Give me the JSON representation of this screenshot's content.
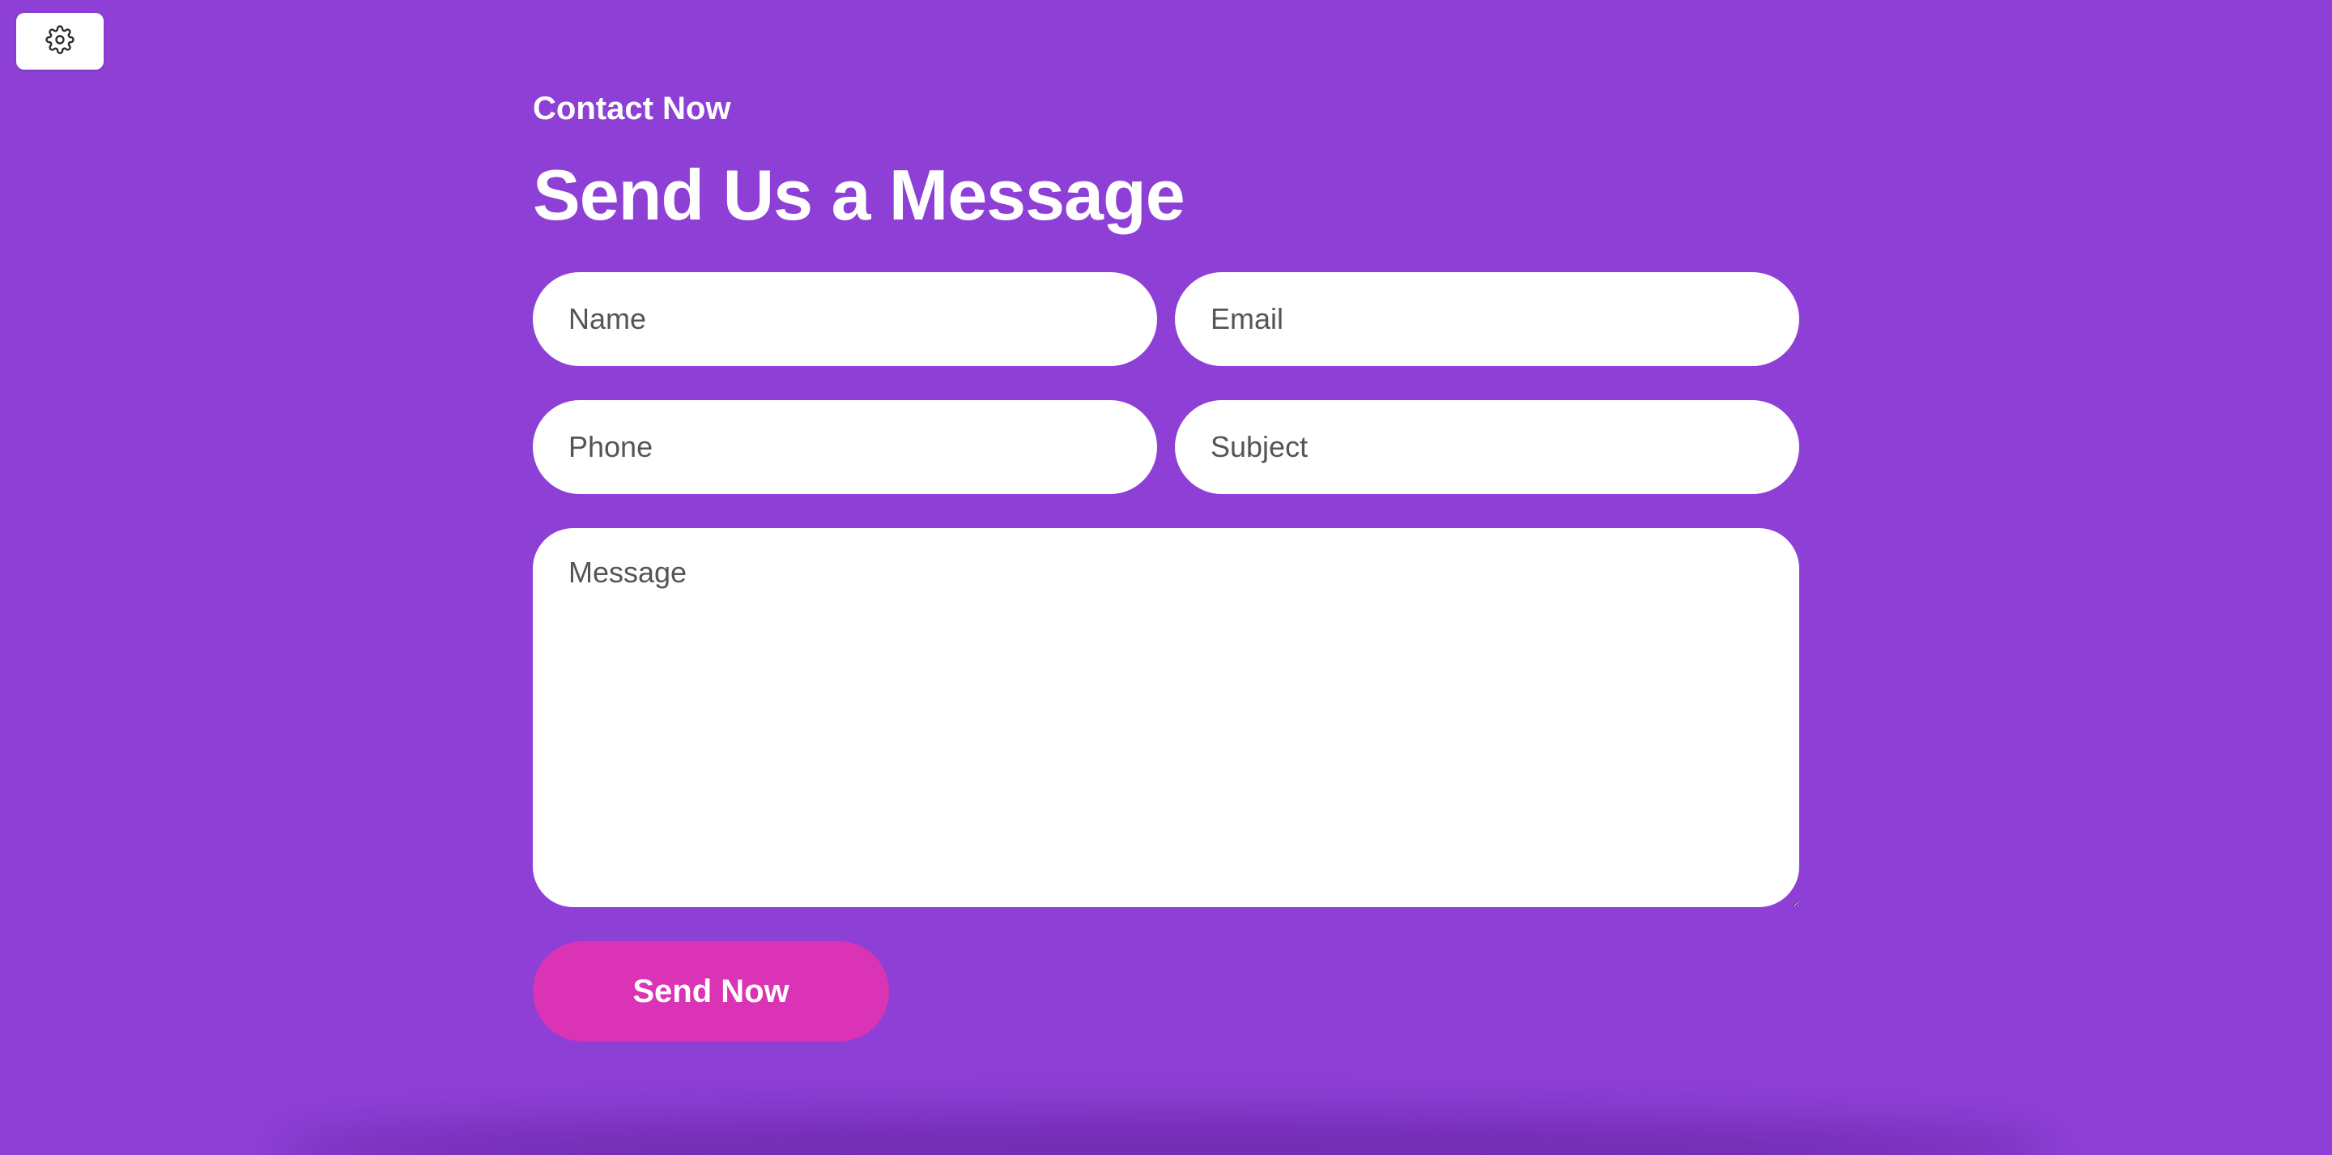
{
  "toolbar": {
    "settings_icon": "gear-icon"
  },
  "header": {
    "eyebrow": "Contact Now",
    "title": "Send Us a Message"
  },
  "form": {
    "name_placeholder": "Name",
    "email_placeholder": "Email",
    "phone_placeholder": "Phone",
    "subject_placeholder": "Subject",
    "message_placeholder": "Message",
    "submit_label": "Send Now"
  },
  "colors": {
    "background": "#8e3fd6",
    "button": "#db33b5",
    "field": "#ffffff",
    "text": "#ffffff"
  }
}
